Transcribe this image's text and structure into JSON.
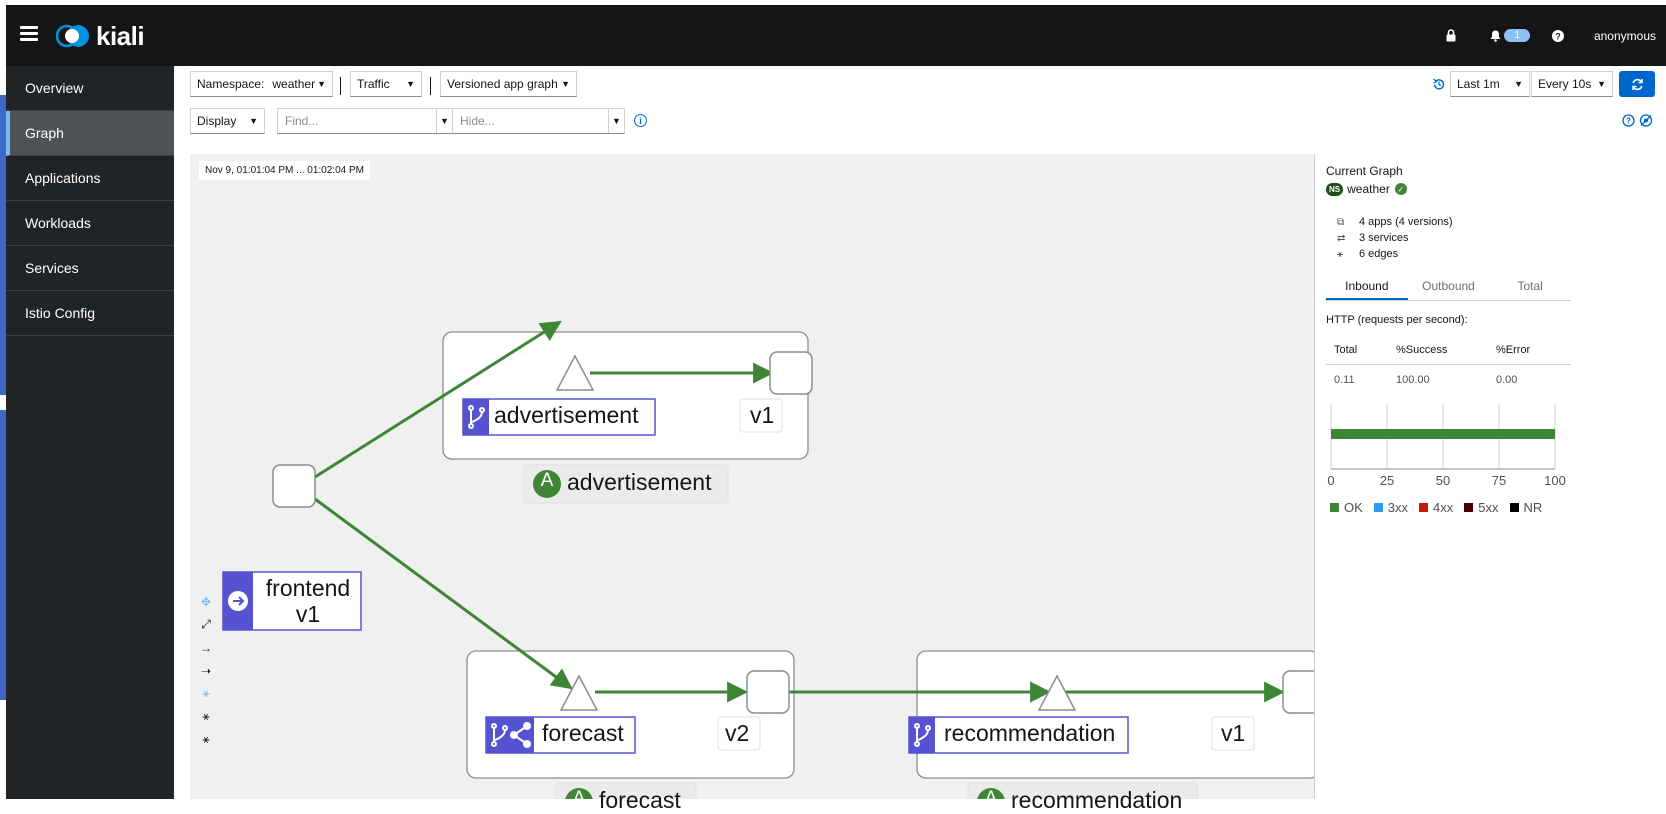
{
  "header": {
    "brand": "kiali",
    "notification_count": "1",
    "user": "anonymous",
    "colors": {
      "masthead": "#151515",
      "badge": "#8bc1f7"
    }
  },
  "sidebar": {
    "items": [
      {
        "label": "Overview",
        "active": false
      },
      {
        "label": "Graph",
        "active": true
      },
      {
        "label": "Applications",
        "active": false
      },
      {
        "label": "Workloads",
        "active": false
      },
      {
        "label": "Services",
        "active": false
      },
      {
        "label": "Istio Config",
        "active": false
      }
    ]
  },
  "toolbar": {
    "namespace_label": "Namespace:",
    "namespace_value": "weather",
    "traffic_label": "Traffic",
    "graph_type": "Versioned app graph",
    "display_label": "Display",
    "find_placeholder": "Find...",
    "hide_placeholder": "Hide...",
    "duration": "Last 1m",
    "refresh_interval": "Every 10s",
    "accent_color": "#0066cc"
  },
  "graph": {
    "timestamp": "Nov 9, 01:01:04 PM ... 01:02:04 PM",
    "nodes": {
      "advertisement_service": "advertisement",
      "advertisement_version": "v1",
      "advertisement_app": "advertisement",
      "frontend_workload": "frontend\nv1",
      "frontend_line1": "frontend",
      "frontend_line2": "v1",
      "forecast_service": "forecast",
      "forecast_version": "v2",
      "forecast_app": "forecast",
      "recommendation_service": "recommendation",
      "recommendation_version": "v1",
      "recommendation_app": "recommendation",
      "app_badge": "A"
    },
    "edge_color": "#3e8635",
    "node_badge_color": "#5752d1"
  },
  "side_panel": {
    "title": "Current Graph",
    "namespace_badge": "NS",
    "namespace": "weather",
    "apps": "4 apps (4 versions)",
    "services": "3 services",
    "edges": "6 edges",
    "tabs": [
      "Inbound",
      "Outbound",
      "Total"
    ],
    "active_tab": "Inbound",
    "http_title": "HTTP (requests per second):",
    "table": {
      "headers": [
        "Total",
        "%Success",
        "%Error"
      ],
      "row": [
        "0.11",
        "100.00",
        "0.00"
      ]
    },
    "chart_ticks": [
      "0",
      "25",
      "50",
      "75",
      "100"
    ],
    "ok_percent": 100,
    "legend": [
      {
        "label": "OK",
        "color": "#3e8635"
      },
      {
        "label": "3xx",
        "color": "#2b9af3"
      },
      {
        "label": "4xx",
        "color": "#c9190b"
      },
      {
        "label": "5xx",
        "color": "#470000"
      },
      {
        "label": "NR",
        "color": "#000000"
      }
    ]
  }
}
